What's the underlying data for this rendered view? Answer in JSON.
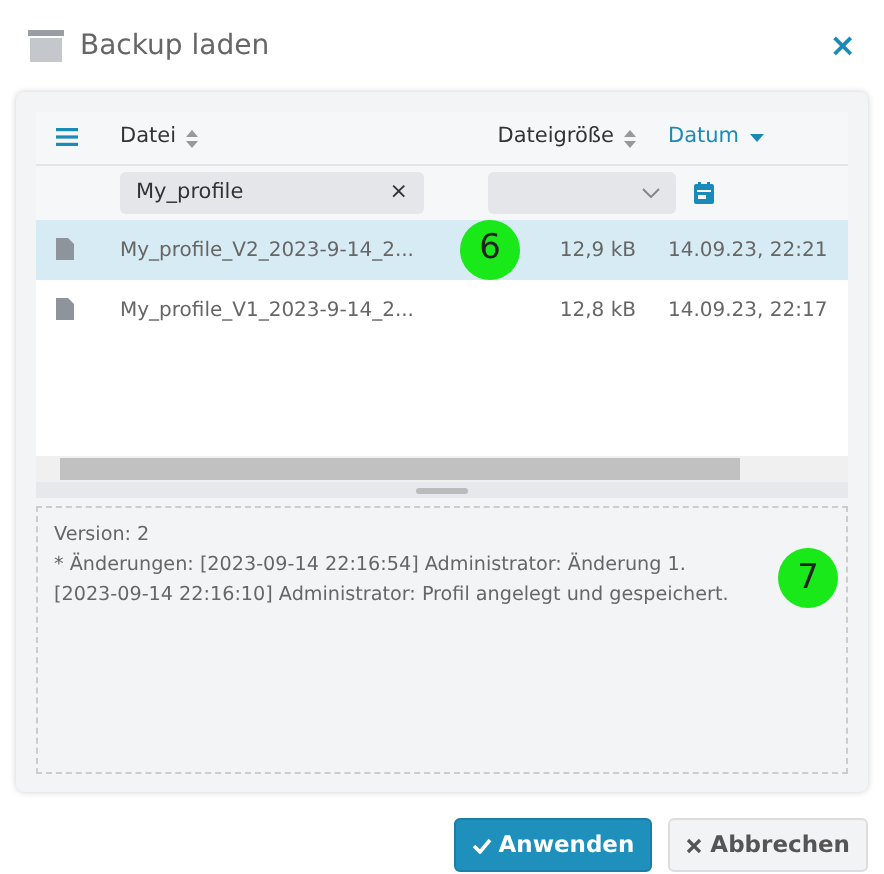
{
  "dialog": {
    "title": "Backup laden",
    "close": "×"
  },
  "table": {
    "columns": [
      {
        "label": "Datei",
        "sorted": false
      },
      {
        "label": "Dateigröße",
        "sorted": false
      },
      {
        "label": "Datum",
        "sorted": true
      }
    ],
    "filter": {
      "value": "My_profile",
      "clear": "×"
    },
    "rows": [
      {
        "name": "My_profile_V2_2023-9-14_2...",
        "size": "12,9 kB",
        "date": "14.09.23, 22:21",
        "selected": true,
        "marker": "6"
      },
      {
        "name": "My_profile_V1_2023-9-14_2...",
        "size": "12,8 kB",
        "date": "14.09.23, 22:17",
        "selected": false
      }
    ]
  },
  "details": {
    "lines": [
      "Version: 2",
      "* Änderungen: [2023-09-14 22:16:54] Administrator: Änderung 1.",
      "[2023-09-14 22:16:10] Administrator: Profil angelegt und gespeichert."
    ],
    "marker": "7"
  },
  "buttons": [
    {
      "label": "Anwenden",
      "kind": "primary"
    },
    {
      "label": "Abbrechen",
      "kind": "secondary"
    }
  ]
}
